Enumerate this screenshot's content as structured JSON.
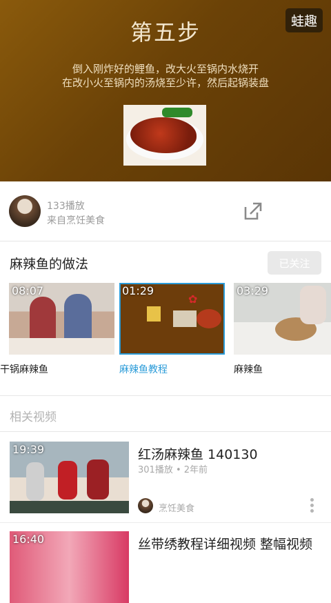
{
  "video": {
    "step_title": "第五步",
    "desc_line1": "倒入刚炸好的鲤鱼，改大火至锅内水烧开",
    "desc_line2": "在改小火至锅内的汤烧至少许，然后起锅装盘",
    "watermark": "蛙趣"
  },
  "uploader": {
    "plays": "133播放",
    "source": "来自烹饪美食",
    "share_icon": "share-icon"
  },
  "series": {
    "title": "麻辣鱼的做法",
    "follow_label": "已关注",
    "items": [
      {
        "duration": "08:07",
        "name": "干锅麻辣鱼"
      },
      {
        "duration": "01:29",
        "name": "麻辣鱼教程"
      },
      {
        "duration": "03:29",
        "name": "麻辣鱼"
      }
    ]
  },
  "related": {
    "header": "相关视频",
    "items": [
      {
        "duration": "19:39",
        "title": "红汤麻辣鱼 140130",
        "meta": "301播放 • 2年前",
        "channel": "烹饪美食"
      },
      {
        "duration": "16:40",
        "title": "丝带绣教程详细视频 整幅视频"
      }
    ]
  },
  "colors": {
    "accent": "#2a9bd8",
    "video_bg": "#7a4c09"
  }
}
